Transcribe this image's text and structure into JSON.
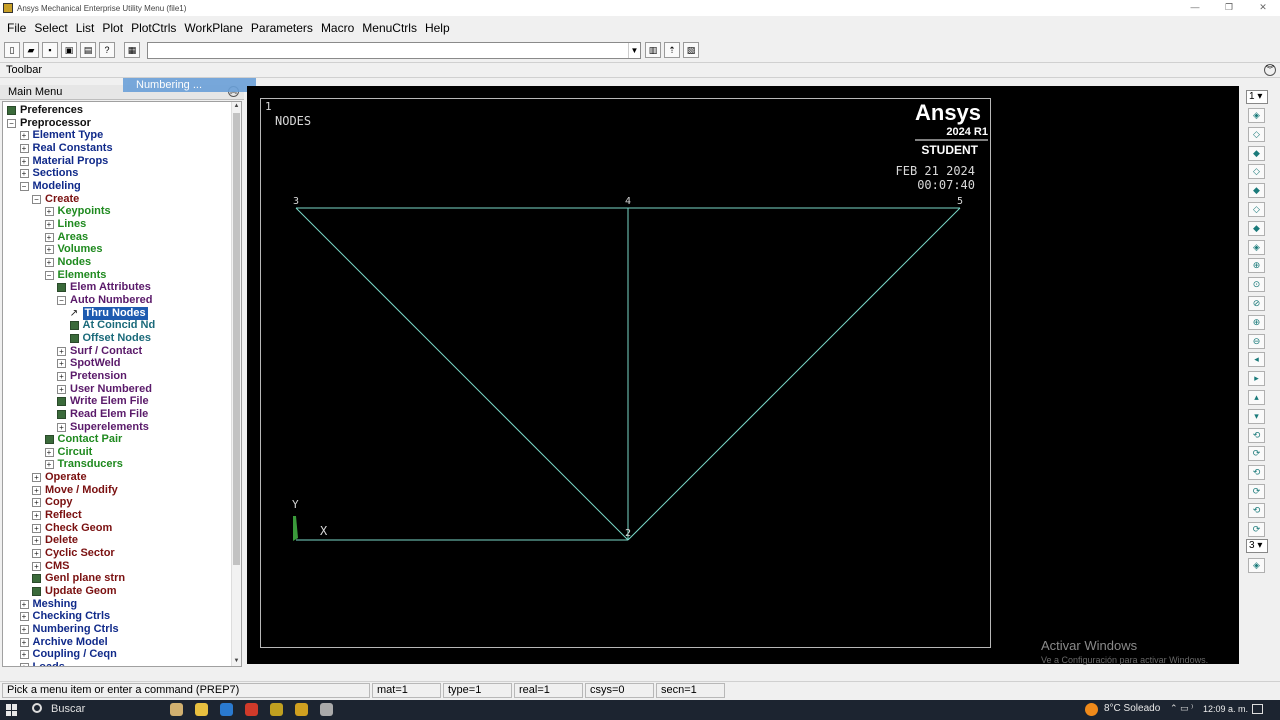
{
  "window": {
    "title": "Ansys Mechanical Enterprise Utility Menu (file1)",
    "controls": {
      "minimize": "—",
      "restore": "❐",
      "close": "✕"
    }
  },
  "menubar": [
    {
      "id": "file",
      "label": "File"
    },
    {
      "id": "select",
      "label": "Select"
    },
    {
      "id": "list",
      "label": "List"
    },
    {
      "id": "plot",
      "label": "Plot"
    },
    {
      "id": "plotctrls",
      "label": "PlotCtrls"
    },
    {
      "id": "workplane",
      "label": "WorkPlane"
    },
    {
      "id": "parameters",
      "label": "Parameters"
    },
    {
      "id": "macro",
      "label": "Macro"
    },
    {
      "id": "menuctrls",
      "label": "MenuCtrls"
    },
    {
      "id": "help",
      "label": "Help"
    }
  ],
  "toolbar": {
    "label": "Toolbar",
    "command_value": "",
    "icons": [
      "new-file-icon",
      "open-folder-icon",
      "save-icon",
      "save-as-icon",
      "print-icon",
      "help-icon"
    ],
    "cmd_icon": "command-window-icon",
    "right_icons": [
      "raise-hidden-icon",
      "reset-picking-icon",
      "contact-manager-icon"
    ]
  },
  "tooltip": {
    "text": "Numbering ..."
  },
  "main_menu": {
    "title": "Main Menu",
    "items": [
      {
        "label": "Preferences",
        "level": 0,
        "glyph": "doc",
        "color": "black"
      },
      {
        "label": "Preprocessor",
        "level": 0,
        "glyph": "minus",
        "color": "black"
      },
      {
        "label": "Element Type",
        "level": 1,
        "glyph": "plus",
        "color": "blue"
      },
      {
        "label": "Real Constants",
        "level": 1,
        "glyph": "plus",
        "color": "blue"
      },
      {
        "label": "Material Props",
        "level": 1,
        "glyph": "plus",
        "color": "blue"
      },
      {
        "label": "Sections",
        "level": 1,
        "glyph": "plus",
        "color": "blue"
      },
      {
        "label": "Modeling",
        "level": 1,
        "glyph": "minus",
        "color": "blue"
      },
      {
        "label": "Create",
        "level": 2,
        "glyph": "minus",
        "color": "red"
      },
      {
        "label": "Keypoints",
        "level": 3,
        "glyph": "plus",
        "color": "green"
      },
      {
        "label": "Lines",
        "level": 3,
        "glyph": "plus",
        "color": "green"
      },
      {
        "label": "Areas",
        "level": 3,
        "glyph": "plus",
        "color": "green"
      },
      {
        "label": "Volumes",
        "level": 3,
        "glyph": "plus",
        "color": "green"
      },
      {
        "label": "Nodes",
        "level": 3,
        "glyph": "plus",
        "color": "green"
      },
      {
        "label": "Elements",
        "level": 3,
        "glyph": "minus",
        "color": "green"
      },
      {
        "label": "Elem Attributes",
        "level": 4,
        "glyph": "doc",
        "color": "purple"
      },
      {
        "label": "Auto Numbered",
        "level": 4,
        "glyph": "minus",
        "color": "purple"
      },
      {
        "label": "Thru Nodes",
        "level": 5,
        "glyph": "arrow",
        "color": "teal",
        "selected": true
      },
      {
        "label": "At Coincid Nd",
        "level": 5,
        "glyph": "doc",
        "color": "teal"
      },
      {
        "label": "Offset Nodes",
        "level": 5,
        "glyph": "doc",
        "color": "teal"
      },
      {
        "label": "Surf / Contact",
        "level": 4,
        "glyph": "plus",
        "color": "purple"
      },
      {
        "label": "SpotWeld",
        "level": 4,
        "glyph": "plus",
        "color": "purple"
      },
      {
        "label": "Pretension",
        "level": 4,
        "glyph": "plus",
        "color": "purple"
      },
      {
        "label": "User Numbered",
        "level": 4,
        "glyph": "plus",
        "color": "purple"
      },
      {
        "label": "Write Elem File",
        "level": 4,
        "glyph": "doc",
        "color": "purple"
      },
      {
        "label": "Read Elem File",
        "level": 4,
        "glyph": "doc",
        "color": "purple"
      },
      {
        "label": "Superelements",
        "level": 4,
        "glyph": "plus",
        "color": "purple"
      },
      {
        "label": "Contact Pair",
        "level": 3,
        "glyph": "doc",
        "color": "green"
      },
      {
        "label": "Circuit",
        "level": 3,
        "glyph": "plus",
        "color": "green"
      },
      {
        "label": "Transducers",
        "level": 3,
        "glyph": "plus",
        "color": "green"
      },
      {
        "label": "Operate",
        "level": 2,
        "glyph": "plus",
        "color": "red"
      },
      {
        "label": "Move / Modify",
        "level": 2,
        "glyph": "plus",
        "color": "red"
      },
      {
        "label": "Copy",
        "level": 2,
        "glyph": "plus",
        "color": "red"
      },
      {
        "label": "Reflect",
        "level": 2,
        "glyph": "plus",
        "color": "red"
      },
      {
        "label": "Check Geom",
        "level": 2,
        "glyph": "plus",
        "color": "red"
      },
      {
        "label": "Delete",
        "level": 2,
        "glyph": "plus",
        "color": "red"
      },
      {
        "label": "Cyclic Sector",
        "level": 2,
        "glyph": "plus",
        "color": "red"
      },
      {
        "label": "CMS",
        "level": 2,
        "glyph": "plus",
        "color": "red"
      },
      {
        "label": "Genl plane strn",
        "level": 2,
        "glyph": "doc",
        "color": "red"
      },
      {
        "label": "Update Geom",
        "level": 2,
        "glyph": "doc",
        "color": "red"
      },
      {
        "label": "Meshing",
        "level": 1,
        "glyph": "plus",
        "color": "blue"
      },
      {
        "label": "Checking Ctrls",
        "level": 1,
        "glyph": "plus",
        "color": "blue"
      },
      {
        "label": "Numbering Ctrls",
        "level": 1,
        "glyph": "plus",
        "color": "blue"
      },
      {
        "label": "Archive Model",
        "level": 1,
        "glyph": "plus",
        "color": "blue"
      },
      {
        "label": "Coupling / Ceqn",
        "level": 1,
        "glyph": "plus",
        "color": "blue"
      },
      {
        "label": "Loads",
        "level": 1,
        "glyph": "plus",
        "color": "blue"
      }
    ]
  },
  "graphics": {
    "window_number": "1",
    "plot_label": "NODES",
    "brand": "Ansys",
    "version": "2024 R1",
    "edition": "STUDENT",
    "date": "FEB 21 2024",
    "time": "00:07:40",
    "axis_x": "X",
    "axis_y": "Y",
    "line_color": "#7ad8c8",
    "nodes": [
      {
        "id": "3",
        "x": 0,
        "y": 1
      },
      {
        "id": "4",
        "x": 1,
        "y": 1
      },
      {
        "id": "5",
        "x": 2,
        "y": 1
      },
      {
        "id": "2",
        "x": 1,
        "y": 0
      },
      {
        "id": "",
        "x": 0,
        "y": 0
      }
    ],
    "segments": [
      [
        0,
        1
      ],
      [
        1,
        2
      ],
      [
        0,
        3
      ],
      [
        1,
        3
      ],
      [
        2,
        3
      ],
      [
        4,
        3
      ]
    ]
  },
  "watermark": {
    "line1": "Activar Windows",
    "line2": "Ve a Configuración para activar Windows."
  },
  "right_toolbar": {
    "window_select": "1",
    "view_select": "3",
    "icons": [
      "iso-view-icon",
      "front-view-icon",
      "top-view-icon",
      "back-view-icon",
      "bottom-view-icon",
      "right-view-icon",
      "left-view-icon",
      "oblique-view-icon",
      "zoom-icon",
      "box-zoom-icon",
      "win-zoom-icon",
      "zoom-in-icon",
      "zoom-out-icon",
      "pan-left-icon",
      "pan-right-icon",
      "pan-up-icon",
      "pan-down-icon",
      "rotate-x-icon",
      "rotate-x-neg-icon",
      "rotate-y-icon",
      "rotate-y-neg-icon",
      "rotate-z-icon",
      "rotate-z-neg-icon"
    ],
    "bottom_icon": "dynamic-mode-icon"
  },
  "statusbar": {
    "prompt": "Pick a menu item or enter a command (PREP7)",
    "mat": "mat=1",
    "type": "type=1",
    "real": "real=1",
    "csys": "csys=0",
    "secn": "secn=1"
  },
  "taskbar": {
    "search": "Buscar",
    "weather": "8°C  Soleado",
    "tray": "⌃  ▭  ⁾",
    "clock": "12:09 a. m.",
    "app_colors": [
      "#d0b070",
      "#e8c040",
      "#2a7ad0",
      "#d03a2a",
      "#c0a020",
      "#d0a020",
      "#aaaaaa"
    ]
  }
}
